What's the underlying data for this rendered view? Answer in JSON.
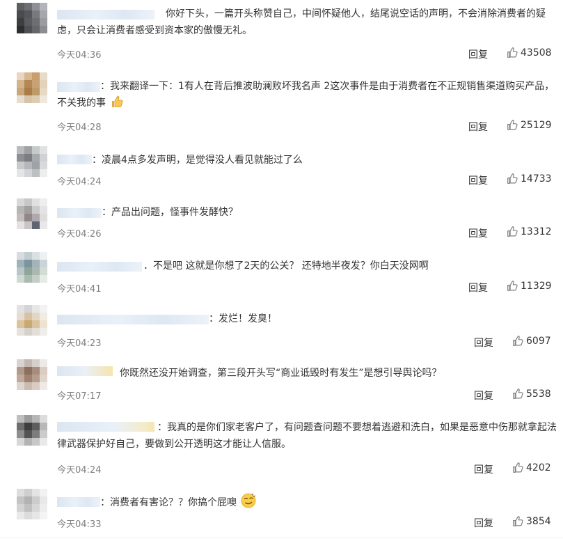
{
  "comments": [
    {
      "id": 1,
      "text": "你好下头，一篇开头称赞自己，中间怀疑他人，结尾说空话的声明，不会消除消费者的疑虑，只会让消费者感受到资本家的傲慢无礼。",
      "time": "今天04:36",
      "reply": "回复",
      "likes": "43508",
      "emoji": ""
    },
    {
      "id": 2,
      "text": "：我来翻译一下：1有人在背后推波助澜败坏我名声 2这次事件是由于消费者在不正规销售渠道购买产品，不关我的事",
      "time": "今天04:28",
      "reply": "回复",
      "likes": "25129",
      "emoji": "thumbs-up-emoji"
    },
    {
      "id": 3,
      "text": "：凌晨4点多发声明，是觉得没人看见就能过了么",
      "time": "今天04:24",
      "reply": "回复",
      "likes": "14733",
      "emoji": ""
    },
    {
      "id": 4,
      "text": "：产品出问题，怪事件发酵快？",
      "time": "今天04:26",
      "reply": "回复",
      "likes": "13312",
      "emoji": ""
    },
    {
      "id": 5,
      "text": "．不是吧 这就是你想了2天的公关？ 还特地半夜发？你白天没网啊",
      "time": "今天04:41",
      "reply": "回复",
      "likes": "11329",
      "emoji": ""
    },
    {
      "id": 6,
      "text": "：发烂！发臭！",
      "time": "今天04:23",
      "reply": "回复",
      "likes": "6097",
      "emoji": ""
    },
    {
      "id": 7,
      "text": "你既然还没开始调查，第三段开头写“商业诋毁时有发生”是想引导舆论吗？",
      "time": "今天07:17",
      "reply": "回复",
      "likes": "5538",
      "emoji": ""
    },
    {
      "id": 8,
      "text": "：我真的是你们家老客户了，有问题查问题不要想着逃避和洗白，如果是恶意中伤那就拿起法律武器保护好自己，要做到公开透明这才能让人信服。",
      "time": "今天04:24",
      "reply": "回复",
      "likes": "4202",
      "emoji": ""
    },
    {
      "id": 9,
      "text": "：消费者有害论？？你搞个屁噢",
      "time": "今天04:33",
      "reply": "回复",
      "likes": "3854",
      "emoji": "smug-emoji"
    }
  ],
  "colors": {
    "text": "#333333",
    "time": "#7f7f7f",
    "icon": "#7f7f7f"
  },
  "icons": {
    "like": "thumbs-up-outline-icon"
  }
}
